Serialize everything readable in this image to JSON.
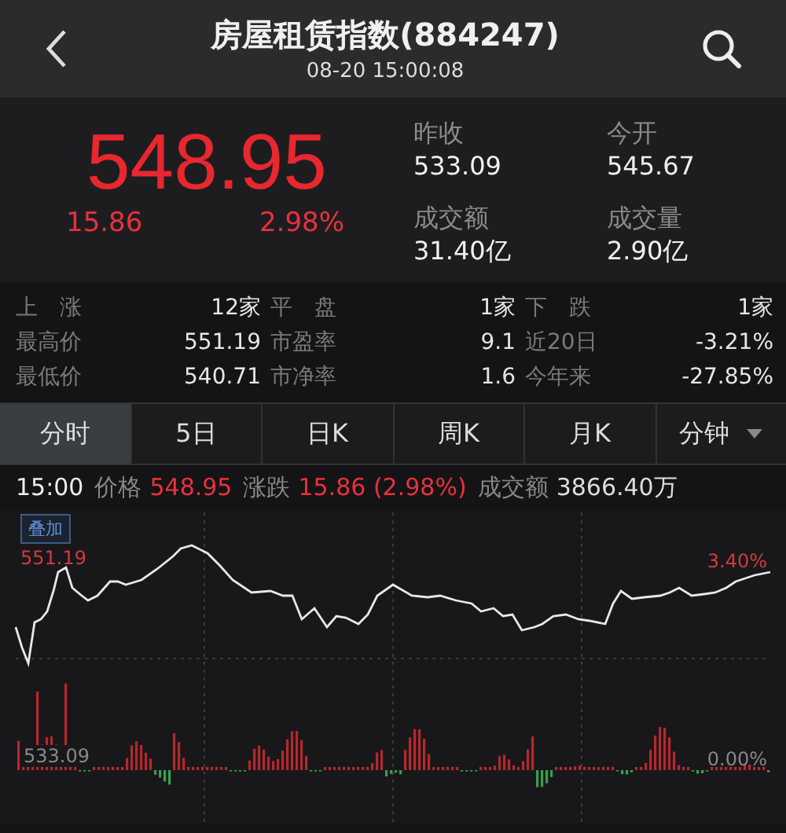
{
  "header": {
    "title": "房屋租赁指数(884247)",
    "timestamp": "08-20 15:00:08"
  },
  "quote": {
    "price": "548.95",
    "change": "15.86",
    "change_pct": "2.98%"
  },
  "stats": [
    {
      "label": "昨收",
      "value": "533.09"
    },
    {
      "label": "今开",
      "value": "545.67"
    },
    {
      "label": "成交额",
      "value": "31.40亿"
    },
    {
      "label": "成交量",
      "value": "2.90亿"
    }
  ],
  "breadth": [
    [
      {
        "label": "上　涨",
        "value": "12家"
      },
      {
        "label": "平　盘",
        "value": "1家"
      },
      {
        "label": "下　跌",
        "value": "1家"
      }
    ],
    [
      {
        "label": "最高价",
        "value": "551.19"
      },
      {
        "label": "市盈率",
        "value": "9.1"
      },
      {
        "label": "近20日",
        "value": "-3.21%"
      }
    ],
    [
      {
        "label": "最低价",
        "value": "540.71"
      },
      {
        "label": "市净率",
        "value": "1.6"
      },
      {
        "label": "今年来",
        "value": "-27.85%"
      }
    ]
  ],
  "tabs": [
    {
      "label": "分时",
      "selected": true,
      "dropdown": false
    },
    {
      "label": "5日",
      "selected": false,
      "dropdown": false
    },
    {
      "label": "日K",
      "selected": false,
      "dropdown": false
    },
    {
      "label": "周K",
      "selected": false,
      "dropdown": false
    },
    {
      "label": "月K",
      "selected": false,
      "dropdown": false
    },
    {
      "label": "分钟",
      "selected": false,
      "dropdown": true
    }
  ],
  "info_line": {
    "time": "15:00",
    "items": [
      {
        "label": "价格",
        "value": "548.95",
        "color": "#e8323c"
      },
      {
        "label": "涨跌",
        "value": "15.86 (2.98%)",
        "color": "#e8323c"
      },
      {
        "label": "成交额",
        "value": "3866.40万",
        "color": "#dddddd"
      }
    ]
  },
  "chart": {
    "overlay_button": "叠加",
    "high_label": "551.19",
    "high_pct": "3.40%",
    "base_label": "533.09",
    "base_pct": "0.00%"
  }
}
